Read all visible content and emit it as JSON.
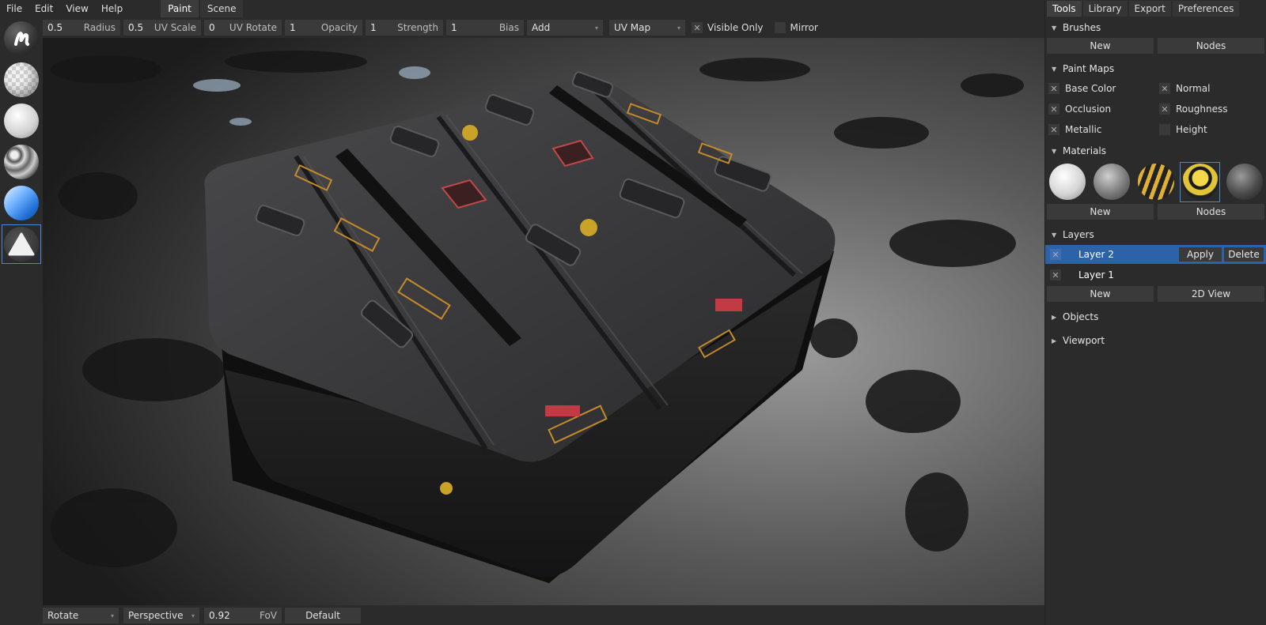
{
  "menu": {
    "file": "File",
    "edit": "Edit",
    "view": "View",
    "help": "Help"
  },
  "workspace_tabs": {
    "paint": "Paint",
    "scene": "Scene"
  },
  "toolbar": {
    "radius": {
      "value": "0.5",
      "label": "Radius"
    },
    "uv_scale": {
      "value": "0.5",
      "label": "UV Scale"
    },
    "uv_rotate": {
      "value": "0",
      "label": "UV Rotate"
    },
    "opacity": {
      "value": "1",
      "label": "Opacity"
    },
    "strength": {
      "value": "1",
      "label": "Strength"
    },
    "bias": {
      "value": "1",
      "label": "Bias"
    },
    "blend_mode": "Add",
    "projection": "UV Map",
    "visible_only": {
      "label": "Visible Only",
      "checked": true
    },
    "mirror": {
      "label": "Mirror",
      "checked": false
    }
  },
  "statusbar": {
    "camera_mode": "Rotate",
    "projection": "Perspective",
    "fov": {
      "value": "0.92",
      "label": "FoV"
    },
    "default_label": "Default"
  },
  "panel": {
    "tabs": {
      "tools": "Tools",
      "library": "Library",
      "export": "Export",
      "preferences": "Preferences"
    },
    "brushes": {
      "title": "Brushes",
      "new": "New",
      "nodes": "Nodes"
    },
    "paint_maps": {
      "title": "Paint Maps",
      "base_color": "Base Color",
      "normal": "Normal",
      "occlusion": "Occlusion",
      "roughness": "Roughness",
      "metallic": "Metallic",
      "height": "Height"
    },
    "materials": {
      "title": "Materials",
      "new": "New",
      "nodes": "Nodes"
    },
    "layers": {
      "title": "Layers",
      "layer2": "Layer 2",
      "layer1": "Layer 1",
      "apply": "Apply",
      "delete": "Delete",
      "new": "New",
      "view2d": "2D View"
    },
    "objects": {
      "title": "Objects"
    },
    "viewport": {
      "title": "Viewport"
    }
  },
  "colors": {
    "accent": "#2b62a8",
    "selection_border": "#4b89d6",
    "panel_bg": "#2b2b2b",
    "field_bg": "#3a3a3a"
  }
}
